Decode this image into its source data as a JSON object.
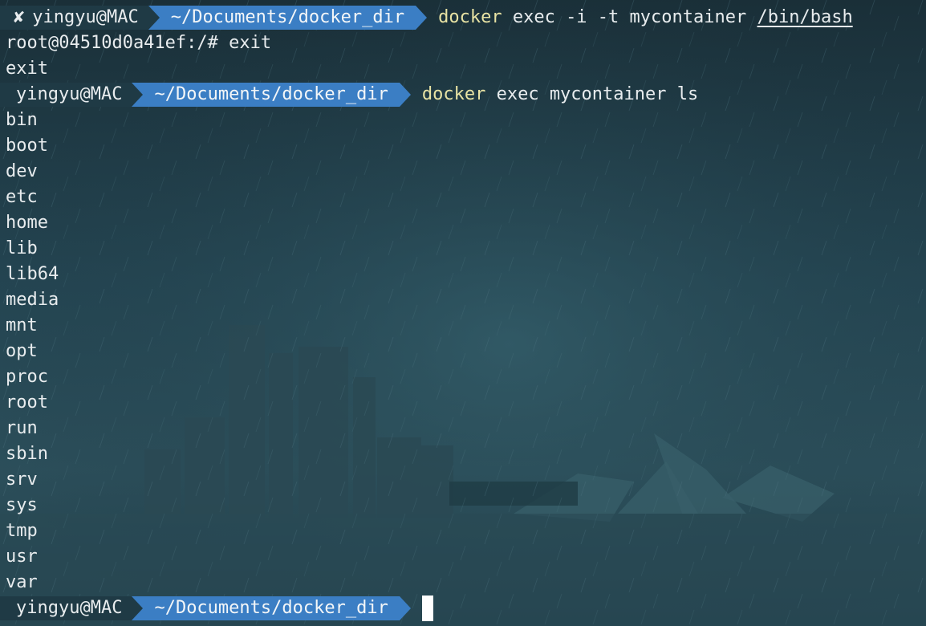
{
  "prompt": {
    "user": "yingyu@MAC",
    "dir": "~/Documents/docker_dir",
    "status_icon": "✘"
  },
  "commands": [
    {
      "name": "docker",
      "args": " exec -i -t mycontainer ",
      "path": "/bin/bash"
    },
    {
      "name": "docker",
      "args": " exec mycontainer ls"
    }
  ],
  "container_session": {
    "prompt_line": "root@04510d0a41ef:/# exit",
    "exit_output": "exit"
  },
  "ls_output": [
    "bin",
    "boot",
    "dev",
    "etc",
    "home",
    "lib",
    "lib64",
    "media",
    "mnt",
    "opt",
    "proc",
    "root",
    "run",
    "sbin",
    "srv",
    "sys",
    "tmp",
    "usr",
    "var"
  ],
  "colors": {
    "background": "#1d3640",
    "user_segment": "#1f3a45",
    "dir_segment": "#3b7ec4",
    "command_name": "#e8e3a4",
    "text": "#e8ecee"
  }
}
